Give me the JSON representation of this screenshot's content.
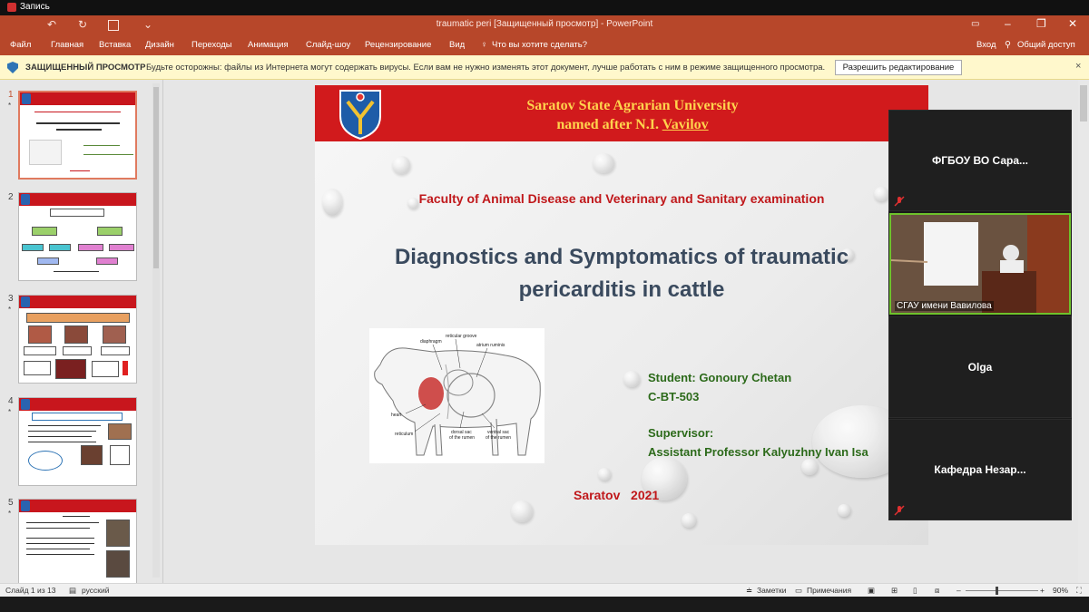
{
  "recording": {
    "label": "Запись"
  },
  "window": {
    "title": "traumatic peri [Защищенный просмотр] - PowerPoint",
    "controls": {
      "minimize": "–",
      "maximize": "❐",
      "close": "✕"
    }
  },
  "ribbon": {
    "tabs": [
      "Файл",
      "Главная",
      "Вставка",
      "Дизайн",
      "Переходы",
      "Анимация",
      "Слайд-шоу",
      "Рецензирование",
      "Вид"
    ],
    "search_hint": "Что вы хотите сделать?",
    "login": "Вход",
    "share": "Общий доступ"
  },
  "protected_view": {
    "title": "ЗАЩИЩЕННЫЙ ПРОСМОТР",
    "message": "Будьте осторожны: файлы из Интернета могут содержать вирусы. Если вам не нужно изменять этот документ, лучше работать с ним в режиме защищенного просмотра.",
    "button": "Разрешить редактирование",
    "close": "×"
  },
  "thumbnails": [
    {
      "num": "1",
      "star": "*",
      "active": true
    },
    {
      "num": "2",
      "star": "",
      "active": false
    },
    {
      "num": "3",
      "star": "*",
      "active": false
    },
    {
      "num": "4",
      "star": "*",
      "active": false
    },
    {
      "num": "5",
      "star": "*",
      "active": false
    }
  ],
  "slide": {
    "university_line1": "Saratov State Agrarian University",
    "university_line2_pre": "named after N.I. ",
    "university_line2_name": "Vavilov",
    "faculty": "Faculty of Animal Disease and Veterinary and Sanitary examination",
    "title": "Diagnostics and Symptomatics of traumatic pericarditis in cattle",
    "figure_labels": {
      "reticular_groove": "reticular groove",
      "diaphragm": "diaphragm",
      "atrium_ruminis": "atrium ruminis",
      "heart": "heart",
      "reticulum": "reticulum",
      "dorsal_sac": "dorsal sac",
      "of_the_rumen_1": "of the rumen",
      "ventral_sac": "ventral sac",
      "of_the_rumen_2": "of the rumen"
    },
    "student_label": "Student: Gonoury Chetan",
    "group": "C-BT-503",
    "supervisor_label": "Supervisor:",
    "supervisor_name": "Assistant Professor Kalyuzhny Ivan Isa",
    "city_year": "Saratov   2021"
  },
  "meeting": {
    "participants": [
      {
        "name": "ФГБОУ ВО Сара...",
        "muted": true
      },
      {
        "name": "СГАУ имени Вавилова",
        "video": true
      },
      {
        "name": "Olga",
        "muted": false
      },
      {
        "name": "Кафедра  Незар...",
        "muted": true
      }
    ]
  },
  "status": {
    "slide": "Слайд 1 из 13",
    "language": "русский",
    "notes": "Заметки",
    "comments": "Примечания",
    "zoom": "90%",
    "minus": "–",
    "plus": "+"
  },
  "colors": {
    "accent": "#b7472a",
    "slide_header": "#d11a1c",
    "univ_text": "#ffd34d",
    "student_text": "#2c6a1a",
    "speaker_border": "#6ec22b"
  }
}
